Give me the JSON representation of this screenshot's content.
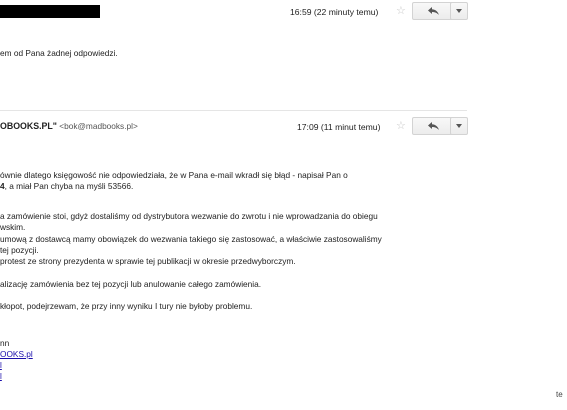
{
  "message1": {
    "timestamp": "16:59 (22 minuty temu)",
    "body_line": "em od Pana żadnej odpowiedzi."
  },
  "message2": {
    "sender_name": "OBOOKS.PL\"",
    "sender_email": "<bok@madbooks.pl>",
    "timestamp": "17:09 (11 minut temu)",
    "body": {
      "l1": "ównie dlatego księgowość nie odpowiedziała, że w Pana e-mail wkradł się błąd - napisał Pan o",
      "l2_bold": "4",
      "l2_rest": ", a miał Pan chyba na myśli 53566.",
      "l3": "a zamówienie stoi, gdyż dostaliśmy od dystrybutora wezwanie do zwrotu i nie wprowadzania do obiegu",
      "l4": "wskim.",
      "l5": "umową z dostawcą mamy obowiązek do wezwania takiego się zastosować, a właściwie zastosowaliśmy",
      "l6": "tej pozycji.",
      "l7": "protest ze strony prezydenta w sprawie tej publikacji w okresie przedwyborczym.",
      "l8": "alizację zamówienia bez tej pozycji lub anulowanie całego zamówienia.",
      "l9": "kłopot, podejrzewam, że przy inny wyniku I tury nie byłoby problemu.",
      "sig1": "nn",
      "sig2": "OOKS.pl",
      "sig3": "l",
      "sig4": "l"
    }
  },
  "corner_text": "te",
  "icons": {
    "star": "star-icon",
    "reply": "reply-arrow-icon",
    "more": "dropdown-arrow-icon"
  },
  "colors": {
    "link": "#1a0dab",
    "star": "#c6c6c6",
    "divider": "#e5e5e5"
  }
}
